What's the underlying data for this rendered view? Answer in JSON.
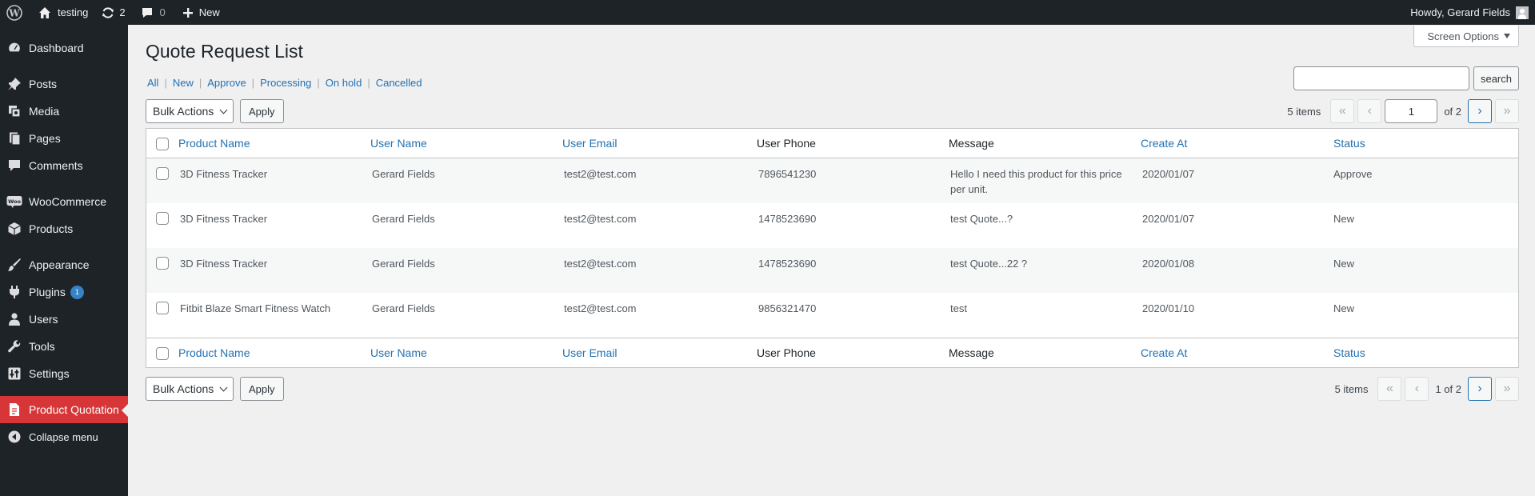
{
  "adminbar": {
    "site_name": "testing",
    "updates_count": "2",
    "comments_count": "0",
    "new_label": "New",
    "howdy": "Howdy, Gerard Fields"
  },
  "sidebar": {
    "items": [
      {
        "label": "Dashboard",
        "icon": "dashboard-icon"
      },
      {
        "label": "Posts",
        "icon": "pushpin-icon"
      },
      {
        "label": "Media",
        "icon": "media-icon"
      },
      {
        "label": "Pages",
        "icon": "pages-icon"
      },
      {
        "label": "Comments",
        "icon": "comment-icon"
      },
      {
        "label": "WooCommerce",
        "icon": "woo-icon"
      },
      {
        "label": "Products",
        "icon": "archive-icon"
      },
      {
        "label": "Appearance",
        "icon": "paintbrush-icon"
      },
      {
        "label": "Plugins",
        "icon": "plugin-icon",
        "badge": "1"
      },
      {
        "label": "Users",
        "icon": "users-icon"
      },
      {
        "label": "Tools",
        "icon": "wrench-icon"
      },
      {
        "label": "Settings",
        "icon": "settings-icon"
      },
      {
        "label": "Product Quotation",
        "icon": "document-icon",
        "current": true
      },
      {
        "label": "Collapse menu",
        "icon": "collapse-icon"
      }
    ]
  },
  "screen_options": "Screen Options",
  "page_title": "Quote Request List",
  "filters": [
    "All",
    "New",
    "Approve",
    "Processing",
    "On hold",
    "Cancelled"
  ],
  "search": {
    "button": "search",
    "value": ""
  },
  "bulk": {
    "select": "Bulk Actions",
    "apply": "Apply"
  },
  "pagination_top": {
    "count": "5 items",
    "first": "«",
    "prev": "‹",
    "current_page": "1",
    "of_text": "of 2",
    "next": "›",
    "last": "»"
  },
  "pagination_bottom": {
    "count": "5 items",
    "first": "«",
    "prev": "‹",
    "page_text": "1 of 2",
    "next": "›",
    "last": "»"
  },
  "table": {
    "columns": [
      "Product Name",
      "User Name",
      "User Email",
      "User Phone",
      "Message",
      "Create At",
      "Status"
    ],
    "rows": [
      {
        "product": "3D Fitness Tracker",
        "user": "Gerard Fields",
        "email": "test2@test.com",
        "phone": "7896541230",
        "message": "Hello I need this product for this price per unit.",
        "date": "2020/01/07",
        "status": "Approve"
      },
      {
        "product": "3D Fitness Tracker",
        "user": "Gerard Fields",
        "email": "test2@test.com",
        "phone": "1478523690",
        "message": "test Quote...?",
        "date": "2020/01/07",
        "status": "New"
      },
      {
        "product": "3D Fitness Tracker",
        "user": "Gerard Fields",
        "email": "test2@test.com",
        "phone": "1478523690",
        "message": "test Quote...22 ?",
        "date": "2020/01/08",
        "status": "New"
      },
      {
        "product": "Fitbit Blaze Smart Fitness Watch",
        "user": "Gerard Fields",
        "email": "test2@test.com",
        "phone": "9856321470",
        "message": "test",
        "date": "2020/01/10",
        "status": "New"
      }
    ]
  }
}
